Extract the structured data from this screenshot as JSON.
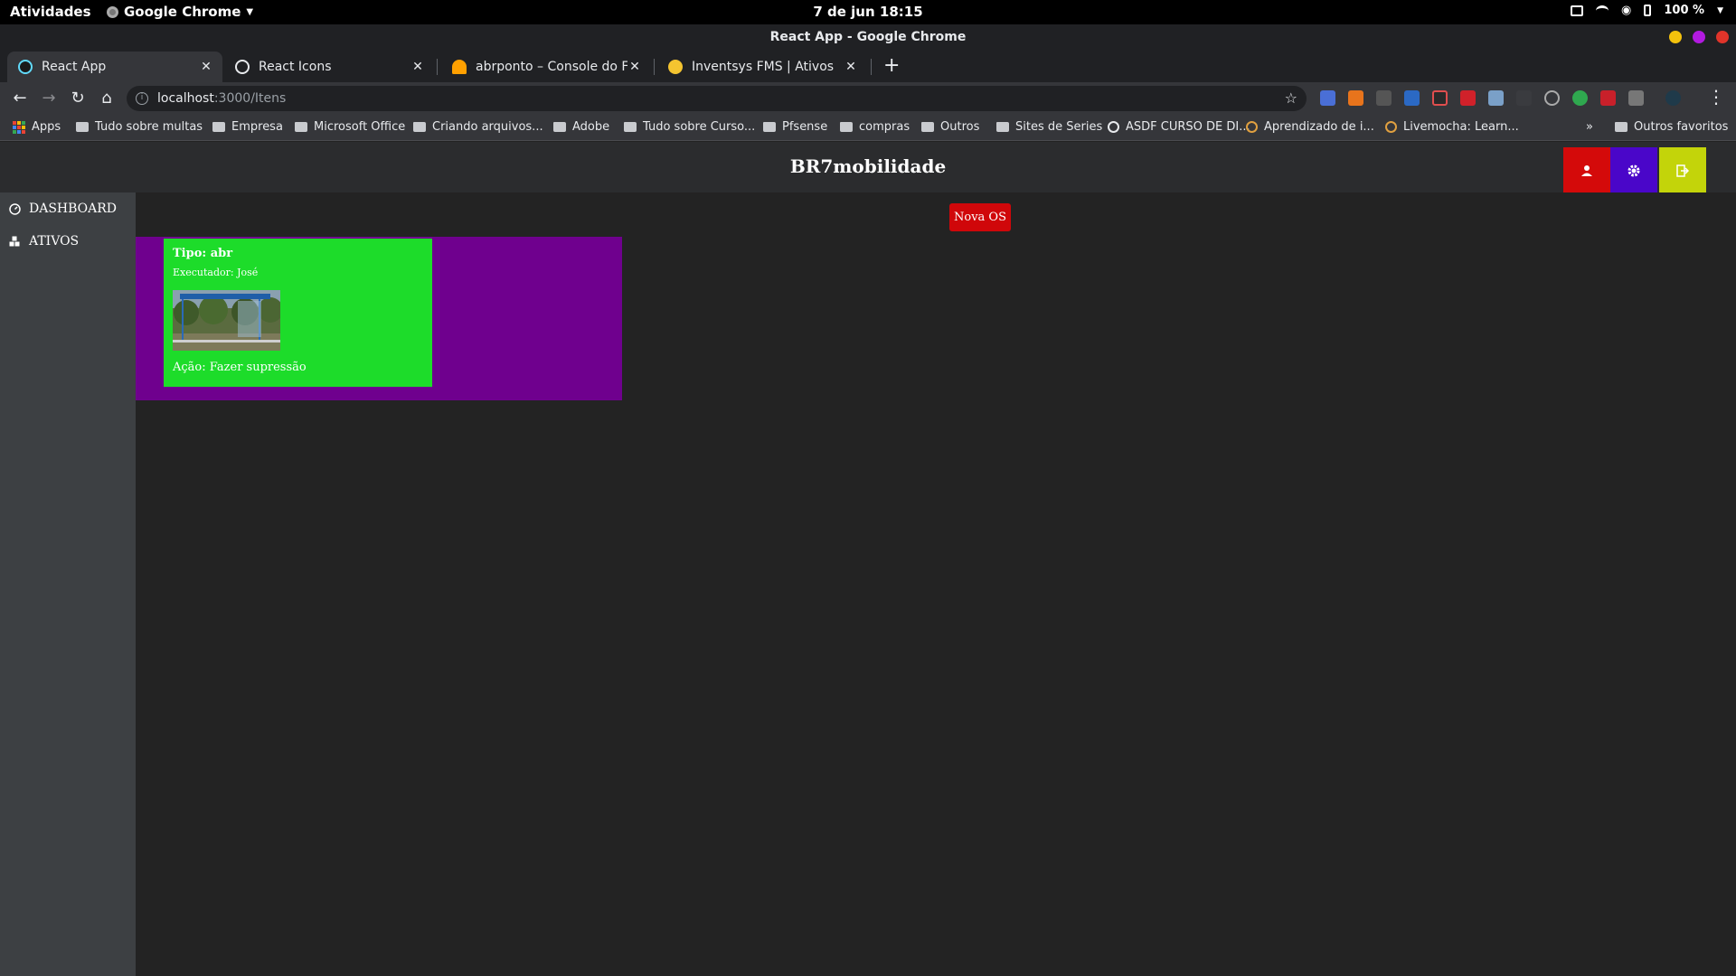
{
  "system_bar": {
    "activities": "Atividades",
    "app_name": "Google Chrome",
    "clock": "7 de jun  18:15",
    "battery": "100 %"
  },
  "window": {
    "title": "React App - Google Chrome"
  },
  "tabs": [
    {
      "label": "React App",
      "icon": "react-icon",
      "color": "#61dafb",
      "active": true
    },
    {
      "label": "React Icons",
      "icon": "globe-icon",
      "color": "#e8eaed",
      "active": false
    },
    {
      "label": "abrponto – Console do Fireba",
      "icon": "firebase-icon",
      "color": "#ffa000",
      "active": false
    },
    {
      "label": "Inventsys FMS | Ativos",
      "icon": "inventsys-icon",
      "color": "#f4c430",
      "active": false
    }
  ],
  "address_bar": {
    "host": "localhost",
    "path": ":3000/Itens"
  },
  "bookmarks": [
    {
      "label": "Apps",
      "type": "apps"
    },
    {
      "label": "Tudo sobre multas",
      "type": "folder"
    },
    {
      "label": "Empresa",
      "type": "folder"
    },
    {
      "label": "Microsoft Office",
      "type": "folder"
    },
    {
      "label": "Criando arquivos...",
      "type": "folder"
    },
    {
      "label": "Adobe",
      "type": "folder"
    },
    {
      "label": "Tudo sobre Curso...",
      "type": "folder"
    },
    {
      "label": "Pfsense",
      "type": "folder"
    },
    {
      "label": "compras",
      "type": "folder"
    },
    {
      "label": "Outros",
      "type": "folder"
    },
    {
      "label": "Sites de Series",
      "type": "folder"
    },
    {
      "label": "ASDF CURSO DE DI...",
      "type": "globe"
    },
    {
      "label": "Aprendizado de i...",
      "type": "swirl"
    },
    {
      "label": "Livemocha: Learn...",
      "type": "swirl"
    }
  ],
  "bookmarks_more": "»",
  "bookmarks_other": "Outros favoritos",
  "app": {
    "brand": "BR7mobilidade",
    "header_buttons": [
      {
        "name": "user-button",
        "icon": "user-icon",
        "color": "#d40a0a"
      },
      {
        "name": "settings-button",
        "icon": "gear-icon",
        "color": "#4a06c9"
      },
      {
        "name": "logout-button",
        "icon": "sign-out-icon",
        "color": "#c3d40a"
      }
    ],
    "sidebar": [
      {
        "label": "DASHBOARD",
        "icon": "dashboard-icon"
      },
      {
        "label": "ATIVOS",
        "icon": "cubes-icon"
      }
    ],
    "new_os_label": "Nova OS",
    "card": {
      "tipo": "Tipo: abr",
      "executor": "Executador: José",
      "acao": "Ação: Fazer supressão"
    }
  }
}
